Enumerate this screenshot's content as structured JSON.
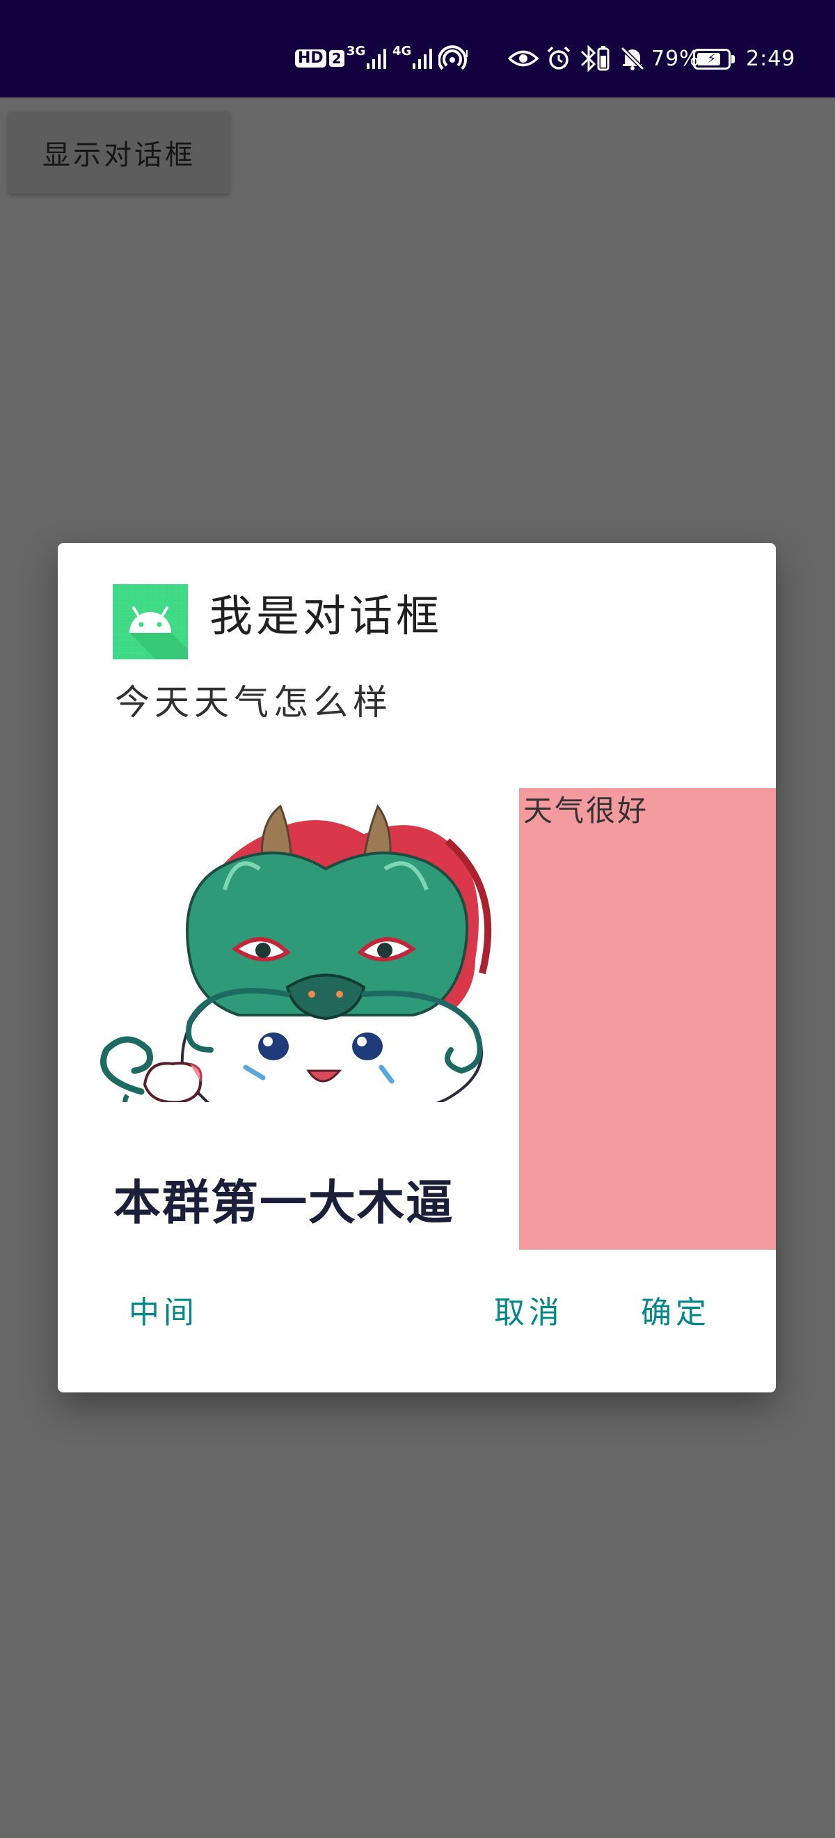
{
  "status_bar": {
    "hd_label": "HD",
    "sim_label": "2",
    "network_3g": "3G",
    "network_4g": "4G",
    "battery_percent": "79%",
    "battery_level": 0.79,
    "time": "2:49",
    "background_color": "#13003f"
  },
  "main": {
    "show_dialog_label": "显示对话框"
  },
  "dialog": {
    "title": "我是对话框",
    "message": "今天天气怎么样",
    "sticker_caption": "本群第一大木逼",
    "side_text": "天气很好",
    "side_panel_color": "#f49b9f",
    "buttons": {
      "neutral": "中间",
      "negative": "取消",
      "positive": "确定"
    },
    "button_color": "#018786"
  }
}
